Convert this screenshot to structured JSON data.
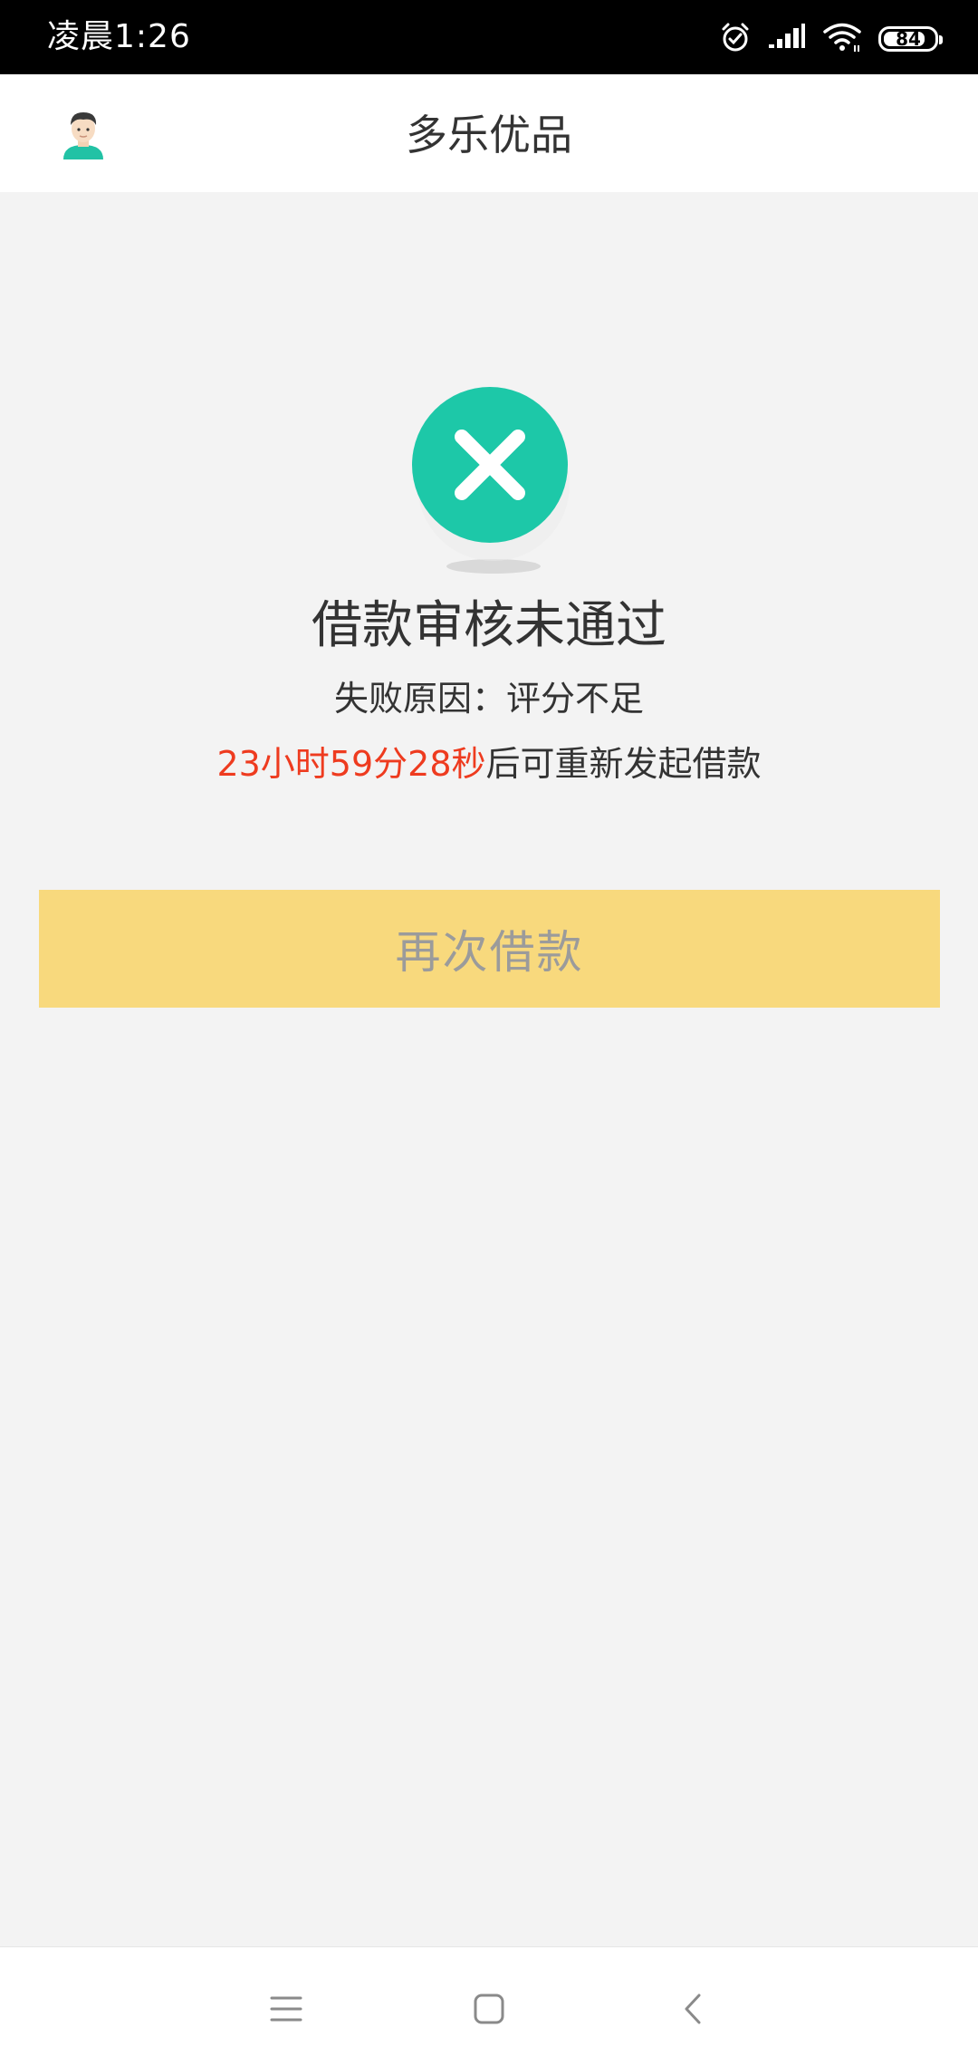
{
  "status_bar": {
    "time": "凌晨1:26",
    "battery_level": "84",
    "battery_fraction": 0.84,
    "icons": [
      "alarm-icon",
      "signal-icon",
      "wifi-icon",
      "battery-icon"
    ]
  },
  "header": {
    "title": "多乐优品",
    "avatar_icon": "avatar-icon"
  },
  "result": {
    "status_icon": "close-circle-icon",
    "title": "借款审核未通过",
    "reason_label": "失败原因",
    "reason_separator": "：",
    "reason_value": "评分不足",
    "countdown": "23小时59分28秒",
    "retry_suffix": "后可重新发起借款"
  },
  "actions": {
    "borrow_again": "再次借款"
  },
  "nav": {
    "items": [
      "menu-icon",
      "home-icon",
      "back-icon"
    ]
  },
  "colors": {
    "accent": "#1dc8a8",
    "button": "#f8d97d",
    "countdown": "#ee3b1f"
  }
}
